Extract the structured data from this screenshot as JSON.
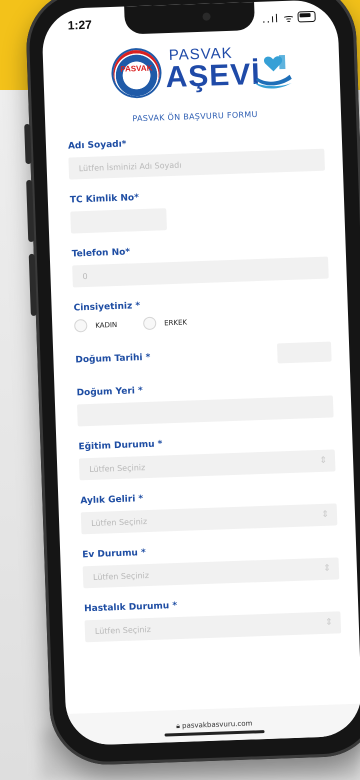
{
  "status": {
    "time": "1:27",
    "icons": "..ıl ᯤ"
  },
  "logo": {
    "seal_text": "PASVAK",
    "top_text": "PASVAK",
    "main_text": "AŞEVİ"
  },
  "form": {
    "title": "PASVAK ÖN BAŞVURU FORMU",
    "name": {
      "label": "Adı Soyadı*",
      "placeholder": "Lütfen İsminizi Adı Soyadı"
    },
    "tc": {
      "label": "TC Kimlik No*",
      "value": ""
    },
    "phone": {
      "label": "Telefon No*",
      "value": "0"
    },
    "gender": {
      "label": "Cinsiyetiniz *",
      "options": [
        "KADIN",
        "ERKEK"
      ]
    },
    "birth_date": {
      "label": "Doğum Tarihi *"
    },
    "birth_place": {
      "label": "Doğum Yeri *",
      "value": ""
    },
    "education": {
      "label": "Eğitim Durumu *",
      "selected": "Lütfen Seçiniz"
    },
    "income": {
      "label": "Aylık Geliri *",
      "selected": "Lütfen Seçiniz"
    },
    "housing": {
      "label": "Ev Durumu *",
      "selected": "Lütfen Seçiniz"
    },
    "health": {
      "label": "Hastalık Durumu *",
      "selected": "Lütfen Seçiniz"
    }
  },
  "browser": {
    "url": "pasvakbasvuru.com"
  },
  "colors": {
    "accent": "#1e4da3",
    "background": "#f3c21a"
  }
}
